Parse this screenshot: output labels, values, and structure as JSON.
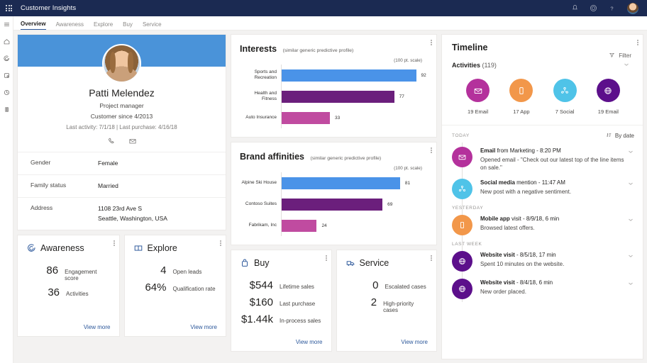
{
  "appbar": {
    "title": "Customer Insights",
    "waffle_icon": "app-launcher-icon",
    "notifications_icon": "bell-icon",
    "settings_icon": "gear-icon",
    "help_icon": "help-icon",
    "avatar_icon": "user-avatar"
  },
  "rail": {
    "items": [
      {
        "icon": "hamburger-menu-icon",
        "name": "menu"
      },
      {
        "icon": "home-icon",
        "name": "home"
      },
      {
        "icon": "awareness-icon",
        "name": "awareness"
      },
      {
        "icon": "explore-icon",
        "name": "explore"
      },
      {
        "icon": "buy-icon",
        "name": "buy"
      },
      {
        "icon": "service-icon",
        "name": "service"
      }
    ]
  },
  "tabs": [
    {
      "label": "Overview",
      "active": true
    },
    {
      "label": "Awareness",
      "active": false
    },
    {
      "label": "Explore",
      "active": false
    },
    {
      "label": "Buy",
      "active": false
    },
    {
      "label": "Service",
      "active": false
    }
  ],
  "profile": {
    "name": "Patti Melendez",
    "role": "Project manager",
    "since": "Customer since 4/2013",
    "last_line": "Last activity: 7/1/18  |  Last purchase: 4/16/18",
    "phone_icon": "phone-icon",
    "email_icon": "envelope-icon",
    "fields": [
      {
        "key": "Gender",
        "value": "Female"
      },
      {
        "key": "Family status",
        "value": "Married"
      },
      {
        "key": "Address",
        "value": "1108 23rd Ave S\nSeattle, Washington, USA"
      }
    ]
  },
  "chart_data": [
    {
      "type": "bar",
      "orientation": "horizontal",
      "title": "Interests",
      "subtitle": "(similar generic predictive profile)",
      "scale_note": "(100 pt. scale)",
      "categories": [
        "Sports and Recreation",
        "Health and Fitness",
        "Auto Insurance"
      ],
      "values": [
        92,
        77,
        33
      ],
      "colors": [
        "#4a93e8",
        "#6b1f7c",
        "#c04ba0"
      ],
      "xlabel": "",
      "ylabel": "",
      "xlim": [
        0,
        100
      ],
      "grid": false,
      "legend": "none"
    },
    {
      "type": "bar",
      "orientation": "horizontal",
      "title": "Brand affinities",
      "subtitle": "(similar generic predictive profile)",
      "scale_note": "(100 pt. scale)",
      "categories": [
        "Alpine Ski House",
        "Contoso Suites",
        "Fabrikam, Inc"
      ],
      "values": [
        81,
        69,
        24
      ],
      "colors": [
        "#4a93e8",
        "#6b1f7c",
        "#c04ba0"
      ],
      "xlabel": "",
      "ylabel": "",
      "xlim": [
        0,
        100
      ],
      "grid": false,
      "legend": "none"
    }
  ],
  "kpis": [
    {
      "title": "Awareness",
      "icon": "awareness-target-icon",
      "rows": [
        {
          "num": "86",
          "label": "Engagement score"
        },
        {
          "num": "36",
          "label": "Activities"
        }
      ],
      "view_more": "View more"
    },
    {
      "title": "Explore",
      "icon": "explore-book-icon",
      "rows": [
        {
          "num": "4",
          "label": "Open leads"
        },
        {
          "num": "64%",
          "label": "Qualification rate"
        }
      ],
      "view_more": "View more"
    },
    {
      "title": "Buy",
      "icon": "shopping-bag-icon",
      "rows": [
        {
          "num": "$544",
          "label": "Lifetime sales"
        },
        {
          "num": "$160",
          "label": "Last purchase"
        },
        {
          "num": "$1.44k",
          "label": "In-process sales"
        }
      ],
      "view_more": "View more"
    },
    {
      "title": "Service",
      "icon": "service-truck-icon",
      "rows": [
        {
          "num": "0",
          "label": "Escalated cases"
        },
        {
          "num": "2",
          "label": "High-priority cases"
        }
      ],
      "view_more": "View more"
    }
  ],
  "timeline": {
    "title": "Timeline",
    "filter_label": "Filter",
    "filter_icon": "funnel-icon",
    "chevron_icon": "chevron-down-icon",
    "activities_label": "Activities",
    "activities_count": "(119)",
    "summary": [
      {
        "label": "19 Email",
        "color": "#b4319c",
        "icon": "envelope-icon"
      },
      {
        "label": "17 App",
        "color": "#f2974a",
        "icon": "mobile-icon"
      },
      {
        "label": "7 Social",
        "color": "#4fc3e8",
        "icon": "social-icon"
      },
      {
        "label": "19 Email",
        "color": "#5c0f8b",
        "icon": "globe-icon"
      }
    ],
    "today_label": "TODAY",
    "sort_label": "By date",
    "sort_icon": "sort-icon",
    "groups": [
      {
        "day": "TODAY",
        "items": [
          {
            "bold": "Email",
            "rest": " from Marketing - 8:20 PM",
            "detail": "Opened  email - \"Check out our latest top of the line items on sale.\"",
            "color": "#b4319c",
            "icon": "envelope-icon"
          },
          {
            "bold": "Social media",
            "rest": " mention - 11:47 AM",
            "detail": "New post with a negative sentiment.",
            "color": "#4fc3e8",
            "icon": "social-icon"
          }
        ]
      },
      {
        "day": "YESTERDAY",
        "items": [
          {
            "bold": "Mobile app",
            "rest": " visit - 8/9/18, 6 min",
            "detail": "Browsed latest offers.",
            "color": "#f2974a",
            "icon": "mobile-icon"
          }
        ]
      },
      {
        "day": "LAST WEEK",
        "items": [
          {
            "bold": "Website visit",
            "rest": " - 8/5/18, 17 min",
            "detail": "Spent 10 minutes on the website.",
            "color": "#5c0f8b",
            "icon": "globe-icon"
          },
          {
            "bold": "Website visit",
            "rest": " - 8/4/18, 6 min",
            "detail": "New order placed.",
            "color": "#5c0f8b",
            "icon": "globe-icon"
          }
        ]
      }
    ]
  },
  "colors": {
    "appbar": "#1b2a52",
    "accent": "#2b579a",
    "banner": "#4a93d9"
  }
}
